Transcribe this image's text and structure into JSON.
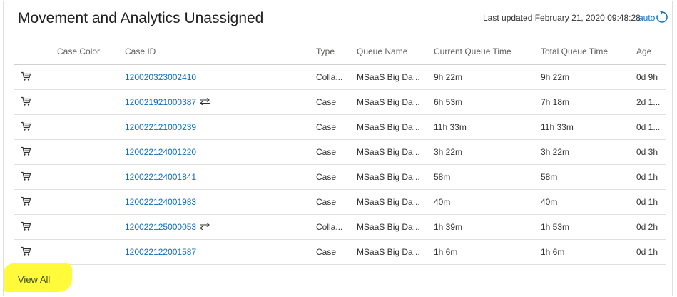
{
  "header": {
    "title": "Movement and Analytics Unassigned",
    "last_updated": "Last updated February 21, 2020 09:48:28",
    "auto_label": "auto"
  },
  "table": {
    "columns": [
      "",
      "Case Color",
      "Case ID",
      "Type",
      "Queue Name",
      "Current Queue Time",
      "Total Queue Time",
      "Age"
    ],
    "rows": [
      {
        "case_id": "120020323002410",
        "transfer": false,
        "type": "Colla...",
        "queue": "MSaaS Big Da...",
        "current": "9h 22m",
        "total": "9h 22m",
        "age": "0d 9h"
      },
      {
        "case_id": "120021921000387",
        "transfer": true,
        "type": "Case",
        "queue": "MSaaS Big Da...",
        "current": "6h 53m",
        "total": "7h 18m",
        "age": "2d 1..."
      },
      {
        "case_id": "120022121000239",
        "transfer": false,
        "type": "Case",
        "queue": "MSaaS Big Da...",
        "current": "11h 33m",
        "total": "11h 33m",
        "age": "0d 1..."
      },
      {
        "case_id": "120022124001220",
        "transfer": false,
        "type": "Case",
        "queue": "MSaaS Big Da...",
        "current": "3h 22m",
        "total": "3h 22m",
        "age": "0d 3h"
      },
      {
        "case_id": "120022124001841",
        "transfer": false,
        "type": "Case",
        "queue": "MSaaS Big Da...",
        "current": "58m",
        "total": "58m",
        "age": "0d 1h"
      },
      {
        "case_id": "120022124001983",
        "transfer": false,
        "type": "Case",
        "queue": "MSaaS Big Da...",
        "current": "40m",
        "total": "40m",
        "age": "0d 1h"
      },
      {
        "case_id": "120022125000053",
        "transfer": true,
        "type": "Colla...",
        "queue": "MSaaS Big Da...",
        "current": "1h 39m",
        "total": "1h 53m",
        "age": "0d 2h"
      },
      {
        "case_id": "120022122001587",
        "transfer": false,
        "type": "Case",
        "queue": "MSaaS Big Da...",
        "current": "1h 6m",
        "total": "1h 6m",
        "age": "0d 1h"
      }
    ]
  },
  "footer": {
    "view_all_label": "View All"
  },
  "icons": {
    "row_action": "cart-icon",
    "transfer": "transfer-arrows-icon",
    "refresh": "refresh-icon"
  },
  "colors": {
    "link": "#0f6cbd",
    "highlight": "#fffa3a"
  }
}
